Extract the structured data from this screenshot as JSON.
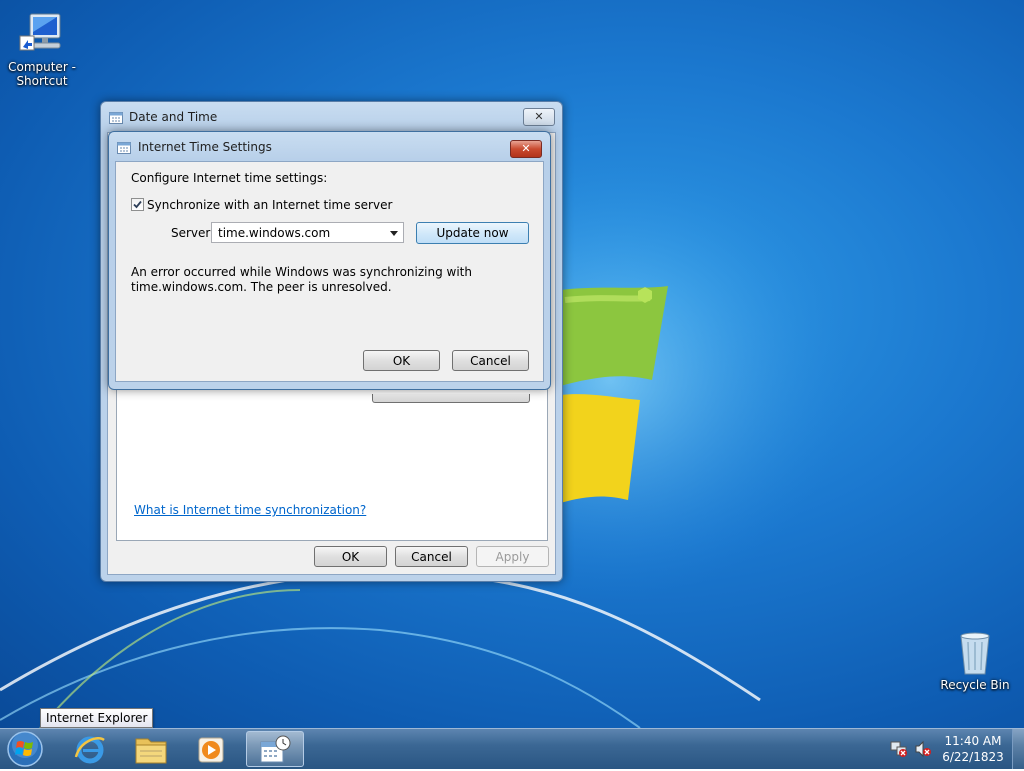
{
  "desktop": {
    "icons": [
      {
        "label_line1": "Computer -",
        "label_line2": "Shortcut",
        "icon": "computer-shortcut-icon"
      },
      {
        "label": "Recycle Bin",
        "icon": "recycle-bin-icon"
      }
    ]
  },
  "date_time_window": {
    "title": "Date and Time",
    "link": "What is Internet time synchronization?",
    "ok": "OK",
    "cancel": "Cancel",
    "apply": "Apply",
    "close": "✕"
  },
  "internet_time_dialog": {
    "title": "Internet Time Settings",
    "heading": "Configure Internet time settings:",
    "sync_label": "Synchronize with an Internet time server",
    "sync_checked": true,
    "server_label": "Server:",
    "server_value": "time.windows.com",
    "update_button": "Update now",
    "error_line1": "An error occurred while Windows was synchronizing with",
    "error_line2": "time.windows.com.  The peer is unresolved.",
    "ok": "OK",
    "cancel": "Cancel",
    "close": "✕"
  },
  "tooltip": "Internet Explorer",
  "taskbar": {
    "apps": [
      "internet-explorer-icon",
      "windows-explorer-icon",
      "media-player-icon",
      "date-time-icon"
    ],
    "clock_time": "11:40 AM",
    "clock_date": "6/22/1823"
  }
}
